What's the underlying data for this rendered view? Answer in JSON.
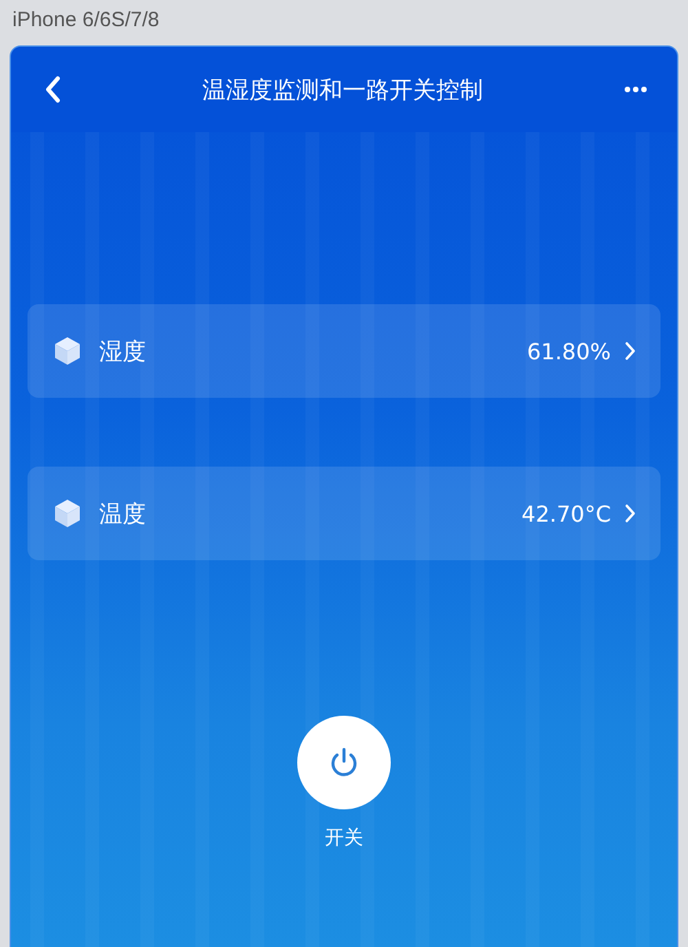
{
  "device_label": "iPhone 6/6S/7/8",
  "header": {
    "title": "温湿度监测和一路开关控制"
  },
  "sensors": [
    {
      "name": "湿度",
      "value": "61.80%"
    },
    {
      "name": "温度",
      "value": "42.70°C"
    }
  ],
  "switch": {
    "label": "开关"
  }
}
